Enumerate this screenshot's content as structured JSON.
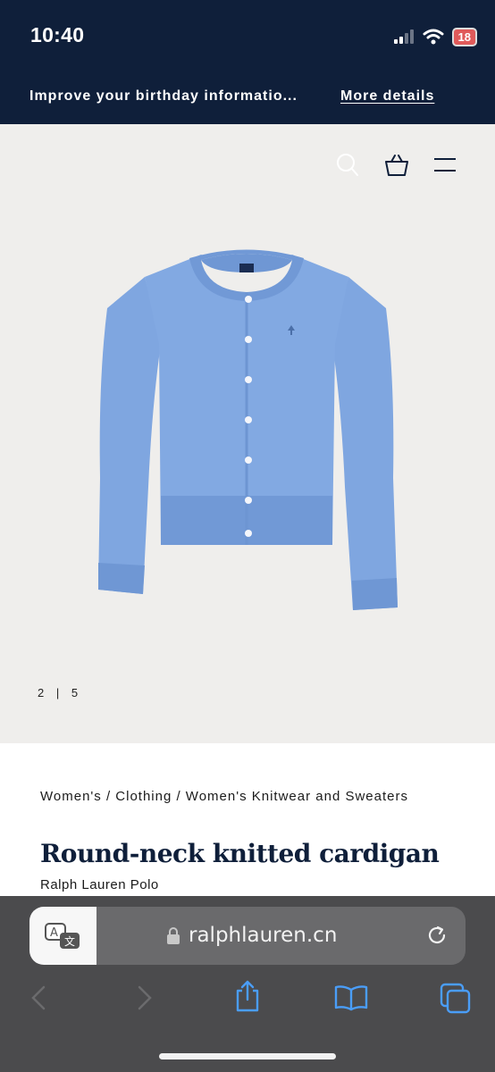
{
  "status_bar": {
    "time": "10:40",
    "battery": "18"
  },
  "promo": {
    "message": "Improve your birthday informatio...",
    "link": "More details"
  },
  "header": {
    "icons": [
      "search-icon",
      "shopping-bag-icon",
      "menu-icon"
    ]
  },
  "gallery": {
    "current": "2",
    "separator": "|",
    "total": "5"
  },
  "product": {
    "breadcrumb": "Women's / Clothing / Women's Knitwear and Sweaters",
    "title": "Round-neck knitted cardigan",
    "brand": "Ralph Lauren Polo",
    "garment_color": "#7fa6e0"
  },
  "browser": {
    "url": "ralphlauren.cn",
    "toolbar_icons": [
      "back-icon",
      "forward-icon",
      "share-icon",
      "bookmarks-icon",
      "tabs-icon"
    ]
  }
}
